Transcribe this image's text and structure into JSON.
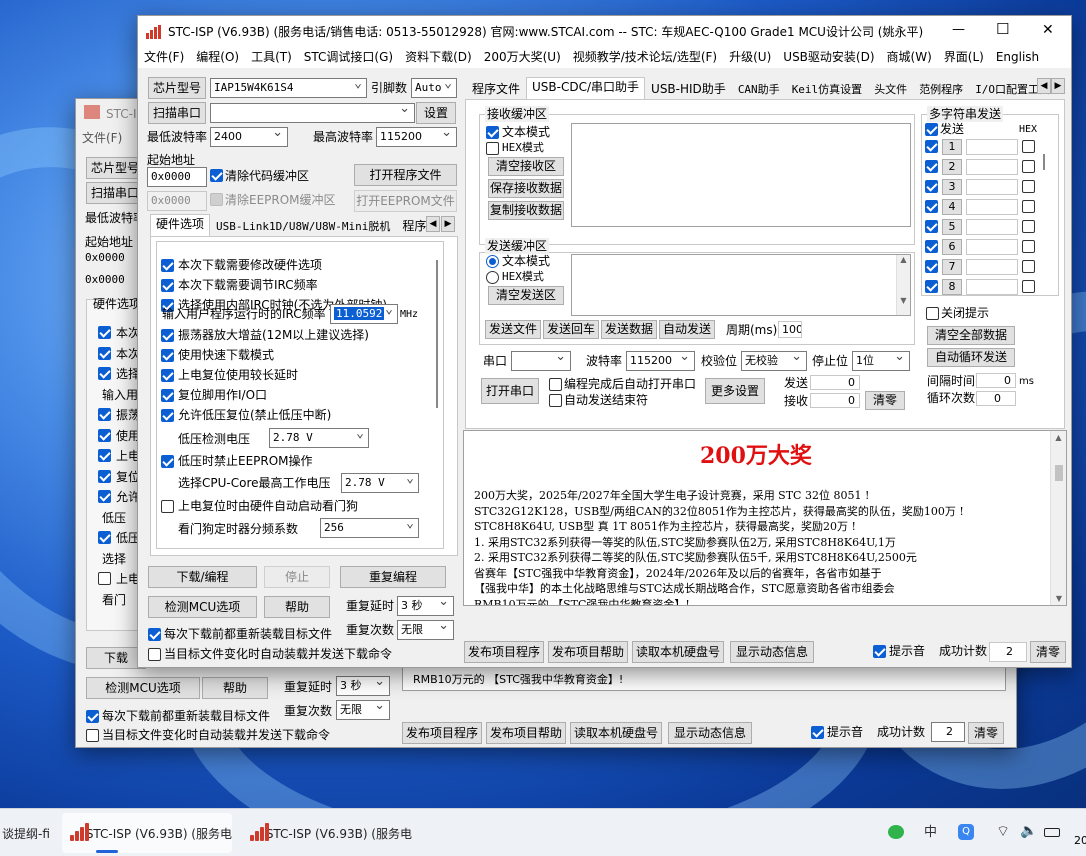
{
  "window": {
    "title": "STC-ISP (V6.93B) (服务电话/销售电话: 0513-55012928) 官网:www.STCAI.com  -- STC: 车规AEC-Q100 Grade1 MCU设计公司 (姚永平)",
    "menu": [
      "文件(F)",
      "编程(O)",
      "工具(T)",
      "STC调试接口(G)",
      "资料下载(D)",
      "200万大奖(U)",
      "视频教学/技术论坛/选型(F)",
      "升级(U)",
      "USB驱动安装(D)",
      "商城(W)",
      "界面(L)",
      "English"
    ],
    "controls": {
      "minimize": "—",
      "maximize": "☐",
      "close": "✕"
    }
  },
  "left": {
    "chip_type_label": "芯片型号",
    "chip_type_value": "IAP15W4K61S4",
    "pin_label": "引脚数",
    "pin_value": "Auto",
    "scan_port_button": "扫描串口",
    "port_value": "",
    "settings_button": "设置",
    "min_baud_label": "最低波特率",
    "min_baud_value": "2400",
    "max_baud_label": "最高波特率",
    "max_baud_value": "115200",
    "start_addr_label": "起始地址",
    "addr1": "0x0000",
    "clear_code_label": "清除代码缓冲区",
    "open_program_button": "打开程序文件",
    "addr2": "0x0000",
    "clear_eeprom_label": "清除EEPROM缓冲区",
    "open_eeprom_button": "打开EEPROM文件",
    "tabs": [
      "硬件选项",
      "USB-Link1D/U8W/U8W-Mini脱机",
      "程序加"
    ],
    "hw_options": [
      {
        "label": "本次下载需要修改硬件选项",
        "checked": true
      },
      {
        "label": "本次下载需要调节IRC频率",
        "checked": true
      },
      {
        "label": "选择使用内部IRC时钟(不选为外部时钟)",
        "checked": true
      }
    ],
    "irc_label": "输入用户程序运行时的IRC频率",
    "irc_value": "11.0592",
    "irc_unit": "MHz",
    "hw_options2": [
      {
        "label": "振荡器放大增益(12M以上建议选择)",
        "checked": true
      },
      {
        "label": "使用快速下载模式",
        "checked": true
      },
      {
        "label": "上电复位使用较长延时",
        "checked": true
      },
      {
        "label": "复位脚用作I/O口",
        "checked": true
      },
      {
        "label": "允许低压复位(禁止低压中断)",
        "checked": true
      }
    ],
    "lv_label": "低压检测电压",
    "lv_value": "2.78 V",
    "eeprom_lv_label": "低压时禁止EEPROM操作",
    "cpu_core_label": "选择CPU-Core最高工作电压",
    "cpu_core_value": "2.78 V",
    "wdt_label": "上电复位时由硬件自动启动看门狗",
    "wdt_div_label": "看门狗定时器分频系数",
    "wdt_div_value": "256",
    "download_button": "下载/编程",
    "stop_button": "停止",
    "reprogram_button": "重复编程",
    "check_mcu_button": "检测MCU选项",
    "help_button": "帮助",
    "repeat_delay_label": "重复延时",
    "repeat_delay_value": "3 秒",
    "repeat_count_label": "重复次数",
    "repeat_count_value": "无限",
    "reload_label": "每次下载前都重新装载目标文件",
    "auto_load_label": "当目标文件变化时自动装载并发送下载命令"
  },
  "right": {
    "tabs": [
      "程序文件",
      "USB-CDC/串口助手",
      "USB-HID助手",
      "CAN助手",
      "Keil仿真设置",
      "头文件",
      "范例程序",
      "I/O口配置工具"
    ],
    "recv_group": "接收缓冲区",
    "text_mode": "文本模式",
    "hex_mode": "HEX模式",
    "clear_recv": "清空接收区",
    "save_recv": "保存接收数据",
    "copy_recv": "复制接收数据",
    "send_group": "发送缓冲区",
    "clear_send": "清空发送区",
    "send_file": "发送文件",
    "send_return": "发送回车",
    "send_data": "发送数据",
    "auto_send": "自动发送",
    "period_label": "周期(ms)",
    "period_value": "100",
    "port_label": "串口",
    "port_value": "",
    "baud_label": "波特率",
    "baud_value": "115200",
    "parity_label": "校验位",
    "parity_value": "无校验",
    "stop_label": "停止位",
    "stop_value": "1位",
    "open_port": "打开串口",
    "auto_open_label": "编程完成后自动打开串口",
    "auto_end_label": "自动发送结束符",
    "more_settings": "更多设置",
    "send_count_label": "发送",
    "send_count": "0",
    "recv_count_label": "接收",
    "recv_count": "0",
    "clear_button": "清零",
    "multi_group": "多字符串发送",
    "multi_send_header": "发送",
    "multi_hex_header": "HEX",
    "multi_rows": [
      "1",
      "2",
      "3",
      "4",
      "5",
      "6",
      "7",
      "8"
    ],
    "close_tip": "关闭提示",
    "clear_all": "清空全部数据",
    "auto_loop": "自动循环发送",
    "interval_label": "间隔时间",
    "interval_value": "0",
    "interval_unit": "ms",
    "loop_label": "循环次数",
    "loop_value": "0"
  },
  "promo": {
    "title": "200万大奖",
    "lines": [
      "200万大奖，2025年/2027年全国大学生电子设计竞赛，采用 STC 32位 8051 !",
      "STC32G12K128，USB型/两组CAN的32位8051作为主控芯片，获得最高奖的队伍，奖励100万 !",
      "STC8H8K64U, USB型 真 1T 8051作为主控芯片，获得最高奖，奖励20万 !",
      "1. 采用STC32系列获得一等奖的队伍,STC奖励参赛队伍2万, 采用STC8H8K64U,1万",
      "2. 采用STC32系列获得二等奖的队伍,STC奖励参赛队伍5千, 采用STC8H8K64U,2500元",
      "省赛年【STC强我中华教育资金】，2024年/2026年及以后的省赛年，各省市如基于",
      "【强我中华】的本土化战略思维与STC达成长期战略合作，STC愿意资助各省市组委会",
      "RMB10万元的 【STC强我中华教育资金】!"
    ]
  },
  "bottom": {
    "publish_program": "发布项目程序",
    "publish_help": "发布项目帮助",
    "read_disk": "读取本机硬盘号",
    "show_dynamic": "显示动态信息",
    "beep_label": "提示音",
    "success_label": "成功计数",
    "success_value": "2",
    "clear": "清零"
  },
  "back_window": {
    "title": "STC-IS",
    "menu": [
      "文件(F)",
      "编"
    ],
    "labels": [
      "芯片型号",
      "扫描串口",
      "最低波特率",
      "起始地址",
      "0x0000",
      "0x0000",
      "硬件选项"
    ],
    "checks": [
      "本次",
      "本次",
      "选择",
      "输入用",
      "振荡",
      "使用",
      "上电",
      "复位",
      "允许",
      "低压",
      "低压",
      "选择",
      "上电",
      "看门"
    ],
    "download": "下载",
    "check_mcu": "检测MCU选项",
    "help": "帮助",
    "delay_label": "重复延时",
    "delay_value": "3 秒",
    "count_label": "重复次数",
    "count_value": "无限",
    "reload": "每次下载前都重新装载目标文件",
    "autoload": "当目标文件变化时自动装载并发送下载命令",
    "promo_lines": [
      "【强我中华】的本土化战略思维与STC达成长期战略合作，STC愿意资助各省市组委会",
      "RMB10万元的 【STC强我中华教育资金】!"
    ],
    "publish_program": "发布项目程序",
    "publish_help": "发布项目帮助",
    "read_disk": "读取本机硬盘号",
    "show_dynamic": "显示动态信息",
    "beep": "提示音",
    "success_label": "成功计数",
    "success_value": "2",
    "clear": "清零"
  },
  "taskbar": {
    "item0": "谈提纲-fi",
    "item1": "STC-ISP (V6.93B) (服务电",
    "item2": "STC-ISP (V6.93B) (服务电",
    "tray_ime": "中",
    "clock": "20"
  }
}
